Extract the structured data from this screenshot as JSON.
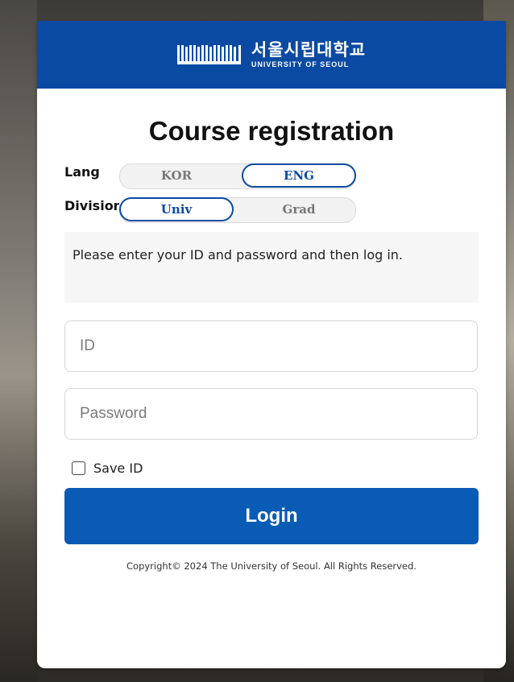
{
  "header": {
    "logo_korean": "서울시립대학교",
    "logo_english": "UNIVERSITY OF SEOUL"
  },
  "title": "Course registration",
  "language": {
    "label": "Lang",
    "options": [
      "KOR",
      "ENG"
    ],
    "selected": "ENG"
  },
  "division": {
    "label": "Division",
    "options": [
      "Univ",
      "Grad"
    ],
    "selected": "Univ"
  },
  "notice": "Please enter your ID and password and then log in.",
  "form": {
    "id_placeholder": "ID",
    "password_placeholder": "Password",
    "save_id_label": "Save ID",
    "save_id_checked": false,
    "login_label": "Login"
  },
  "footer": {
    "copyright": "Copyright© 2024 The University of Seoul. All Rights Reserved."
  },
  "colors": {
    "brand_blue": "#0a4aa3",
    "button_blue": "#0a5bb5"
  }
}
